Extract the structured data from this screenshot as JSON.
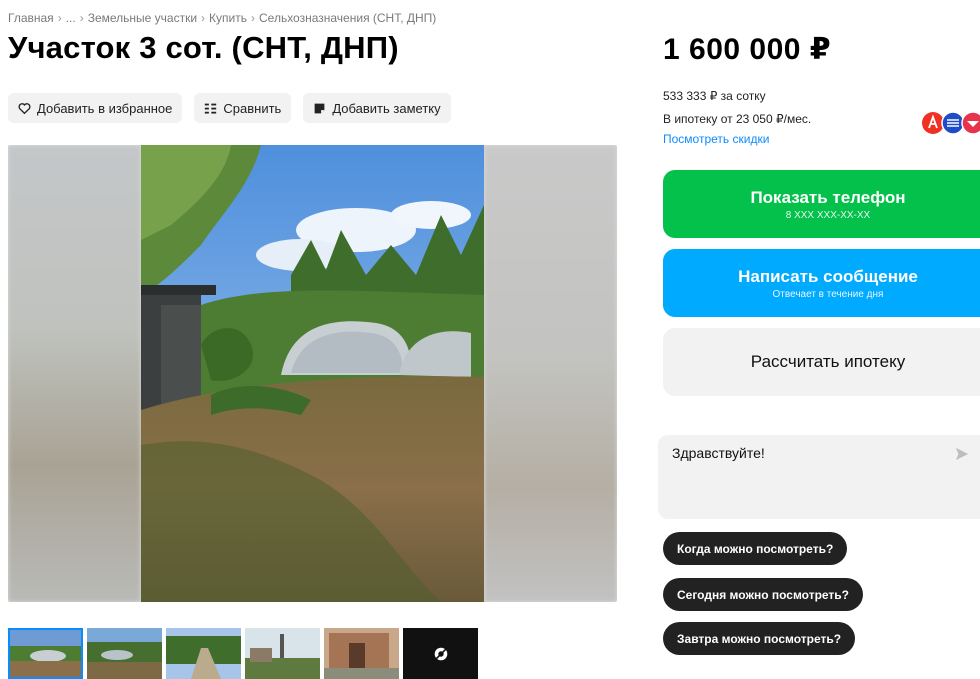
{
  "breadcrumb": {
    "items": [
      "Главная",
      "...",
      "Земельные участки",
      "Купить",
      "Сельхозназначения (СНТ, ДНП)"
    ],
    "separator": "›"
  },
  "listing": {
    "title": "Участок 3 сот. (СНТ, ДНП)"
  },
  "actions": {
    "favorite_label": "Добавить в избранное",
    "compare_label": "Сравнить",
    "note_label": "Добавить заметку"
  },
  "gallery": {
    "thumbnails_count": 5,
    "more_icon": "camera-off-icon"
  },
  "sidebar": {
    "price": "1 600 000 ₽",
    "price_per_sotka": "533 333 ₽ за сотку",
    "mortgage_text": "В ипотеку от 23 050 ₽/мес.",
    "discounts_link": "Посмотреть скидки",
    "bank_icons": [
      "alfa-bank-icon",
      "bank-icon",
      "bank-icon"
    ]
  },
  "contact": {
    "phone_label": "Показать телефон",
    "phone_masked": "8 XXX XXX-XX-XX",
    "message_label": "Написать сообщение",
    "message_sub": "Отвечает в течение дня",
    "mortgage_calc_label": "Рассчитать ипотеку"
  },
  "message": {
    "text": "Здравствуйте!"
  },
  "quick_replies": [
    "Когда можно посмотреть?",
    "Сегодня можно посмотреть?",
    "Завтра можно посмотреть?"
  ],
  "colors": {
    "phone_button": "#04c14c",
    "message_button": "#00aaff",
    "link": "#0a8cff"
  }
}
